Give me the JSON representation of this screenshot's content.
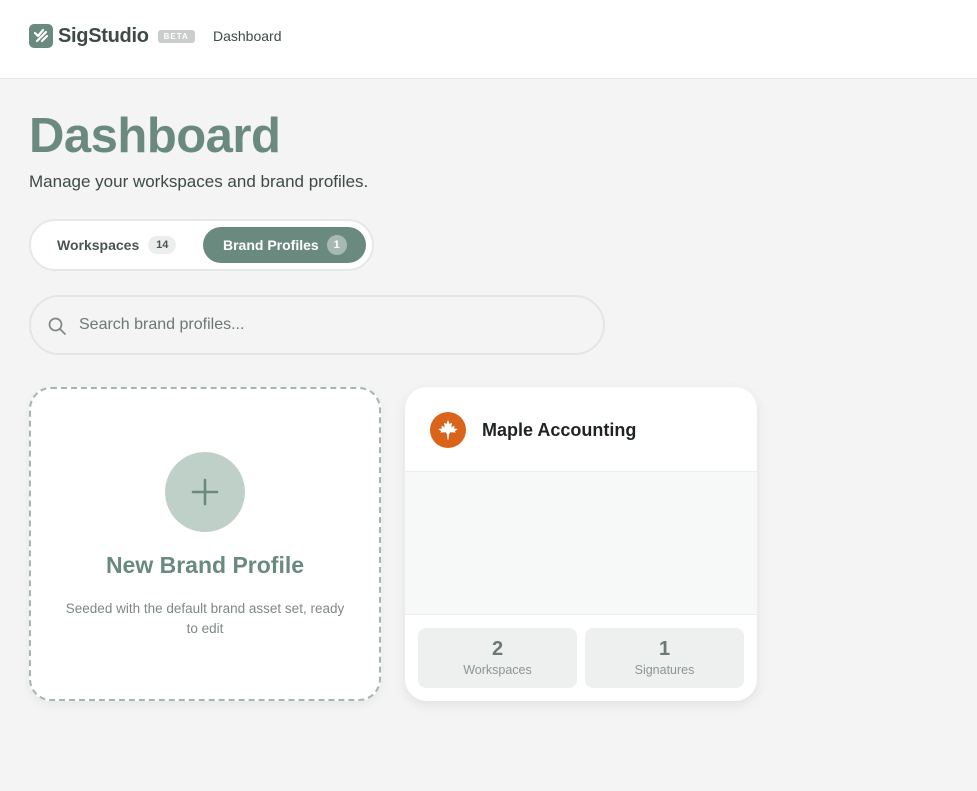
{
  "app": {
    "name": "SigStudio",
    "badge": "BETA",
    "nav_link": "Dashboard",
    "accent_color": "#6a8a7f"
  },
  "page": {
    "title": "Dashboard",
    "subtitle": "Manage your workspaces and brand profiles."
  },
  "tabs": [
    {
      "label": "Workspaces",
      "count": "14",
      "active": false
    },
    {
      "label": "Brand Profiles",
      "count": "1",
      "active": true
    }
  ],
  "search": {
    "placeholder": "Search brand profiles...",
    "value": "",
    "icon": "search-icon"
  },
  "new_card": {
    "icon": "plus-icon",
    "title": "New Brand Profile",
    "description": "Seeded with the default brand asset set, ready to edit"
  },
  "brand_profiles": [
    {
      "name": "Maple Accounting",
      "logo_icon": "maple-leaf-icon",
      "logo_color": "#d9641a",
      "stats": [
        {
          "value": "2",
          "label": "Workspaces"
        },
        {
          "value": "1",
          "label": "Signatures"
        }
      ]
    }
  ]
}
